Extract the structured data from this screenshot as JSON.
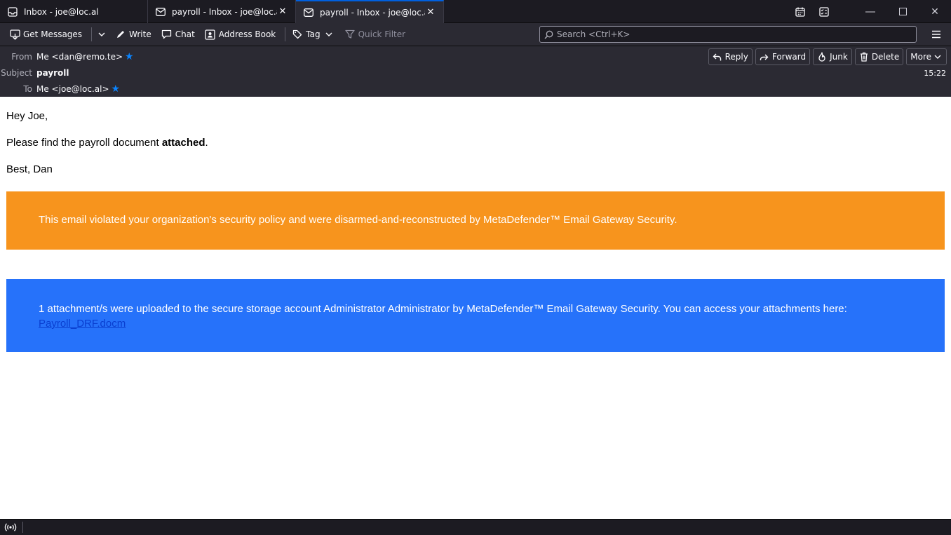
{
  "tabs": [
    {
      "label": "Inbox - joe@loc.al",
      "icon": "inbox-icon"
    },
    {
      "label": "payroll - Inbox - joe@loc.al",
      "icon": "mail-icon"
    },
    {
      "label": "payroll - Inbox - joe@loc.al",
      "icon": "mail-icon"
    }
  ],
  "toolbar": {
    "get_messages": "Get Messages",
    "write": "Write",
    "chat": "Chat",
    "address_book": "Address Book",
    "tag": "Tag",
    "quick_filter": "Quick Filter",
    "search_placeholder": "Search <Ctrl+K>"
  },
  "header": {
    "from_label": "From",
    "from_value": "Me <dan@remo.te>",
    "subject_label": "Subject",
    "subject_value": "payroll",
    "to_label": "To",
    "to_value": "Me <joe@loc.al>",
    "time": "15:22",
    "buttons": {
      "reply": "Reply",
      "forward": "Forward",
      "junk": "Junk",
      "delete": "Delete",
      "more": "More"
    }
  },
  "body": {
    "greeting": "Hey Joe,",
    "line1_before": "Please find the payroll document ",
    "line1_bold": "attached",
    "line1_after": ".",
    "signoff": "Best, Dan",
    "orange_banner": "This email violated your organization's security policy and were disarmed-and-reconstructed by MetaDefender™ Email Gateway Security.",
    "blue_banner": "1 attachment/s were uploaded to the secure storage account Administrator Administrator by MetaDefender™ Email Gateway Security. You can access your attachments here:",
    "attachment_link": "Payroll_DRF.docm"
  },
  "colors": {
    "orange": "#f7941d",
    "blue": "#2672fa",
    "accent": "#0a84ff"
  }
}
